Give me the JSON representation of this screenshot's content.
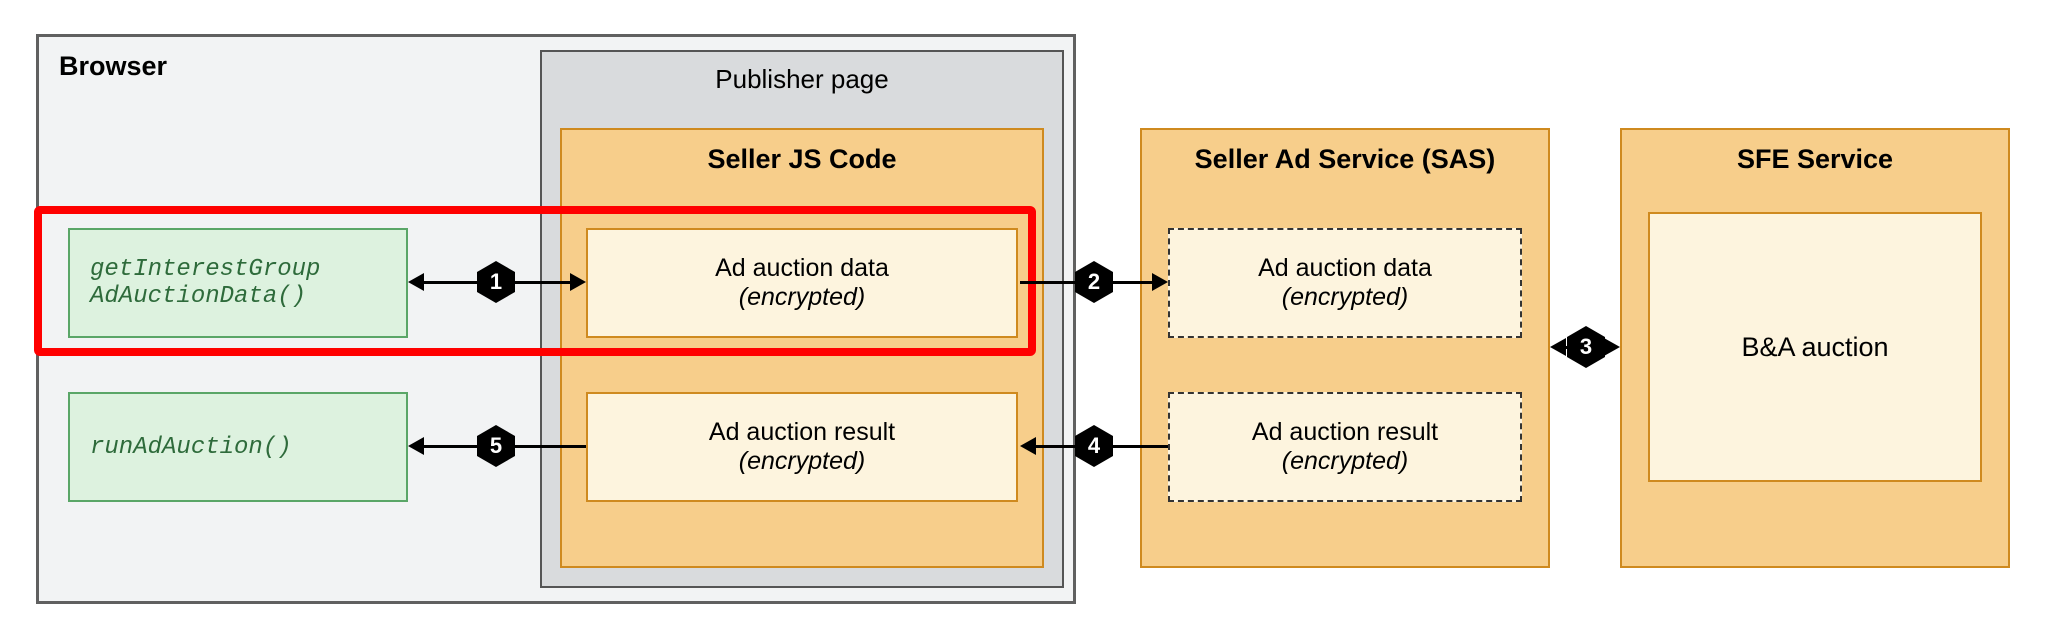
{
  "browser": {
    "title": "Browser"
  },
  "publisher": {
    "title": "Publisher page"
  },
  "seller_js": {
    "title": "Seller JS Code",
    "data_box": {
      "line1": "Ad auction data",
      "line2": "(encrypted)"
    },
    "result_box": {
      "line1": "Ad auction result",
      "line2": "(encrypted)"
    }
  },
  "sas": {
    "title": "Seller Ad Service (SAS)",
    "data_box": {
      "line1": "Ad auction data",
      "line2": "(encrypted)"
    },
    "result_box": {
      "line1": "Ad auction result",
      "line2": "(encrypted)"
    }
  },
  "sfe": {
    "title": "SFE Service",
    "main_box": "B&A auction"
  },
  "api": {
    "get_ig_line1": "getInterestGroup",
    "get_ig_line2": "AdAuctionData()",
    "run_auction": "runAdAuction()"
  },
  "steps": {
    "s1": "1",
    "s2": "2",
    "s3": "3",
    "s4": "4",
    "s5": "5"
  }
}
